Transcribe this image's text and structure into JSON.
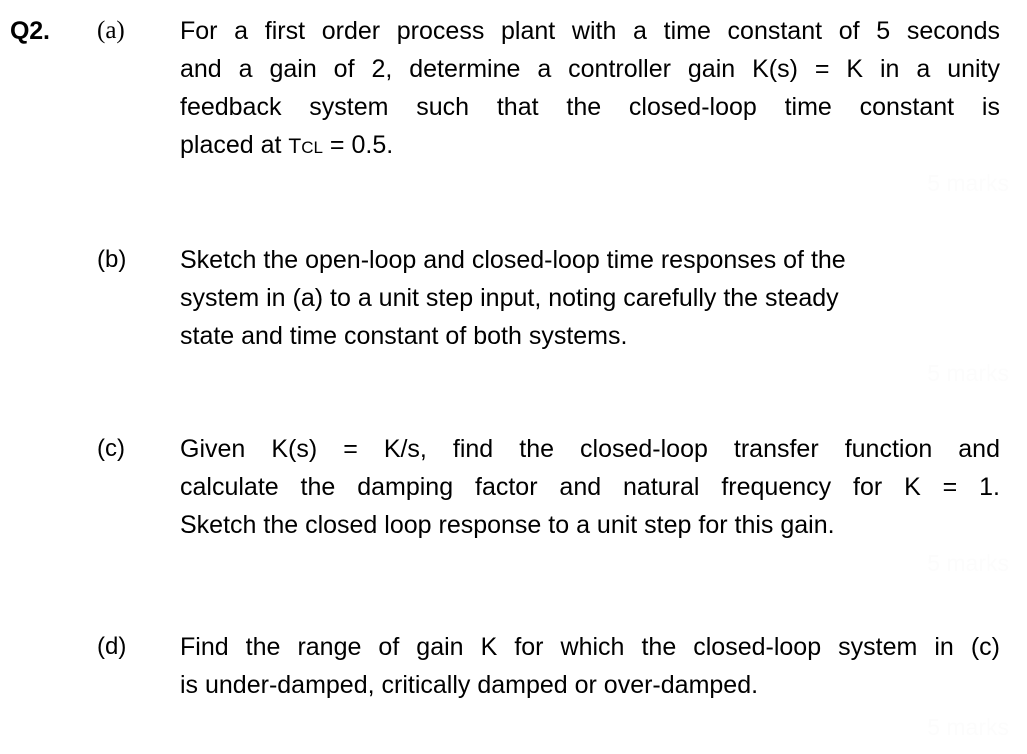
{
  "document": {
    "question_number": "Q2.",
    "background_color": "#ffffff",
    "text_color": "#000000",
    "marks_color": "#fcfcfc"
  },
  "parts": {
    "a": {
      "label": "(a)",
      "line1": "For a first order process plant with a time constant of 5 seconds",
      "line2": "and a gain of 2, determine a controller gain K(s) = K in a unity",
      "line3": "feedback system such that the closed-loop time constant is",
      "line4_pre": "placed at ",
      "line4_symbol_t": "T",
      "line4_symbol_sub": "CL",
      "line4_post": " = 0.5.",
      "marks": "5 marks"
    },
    "b": {
      "label": "(b)",
      "line1": "Sketch the open-loop and closed-loop time responses of the",
      "line2": "system in (a) to a unit step input, noting carefully the steady",
      "line3": "state and time constant of both systems.",
      "marks": "5 marks"
    },
    "c": {
      "label": "(c)",
      "line1": "Given K(s) = K/s, find the closed-loop transfer function and",
      "line2": "calculate the damping factor and natural frequency for K = 1.",
      "line3": "Sketch the closed loop response to a unit step for this gain.",
      "marks": "5 marks"
    },
    "d": {
      "label": "(d)",
      "line1": "Find the range of gain K for which the closed-loop system in (c)",
      "line2": "is under-damped, critically damped or over-damped.",
      "marks": "5 marks"
    }
  }
}
